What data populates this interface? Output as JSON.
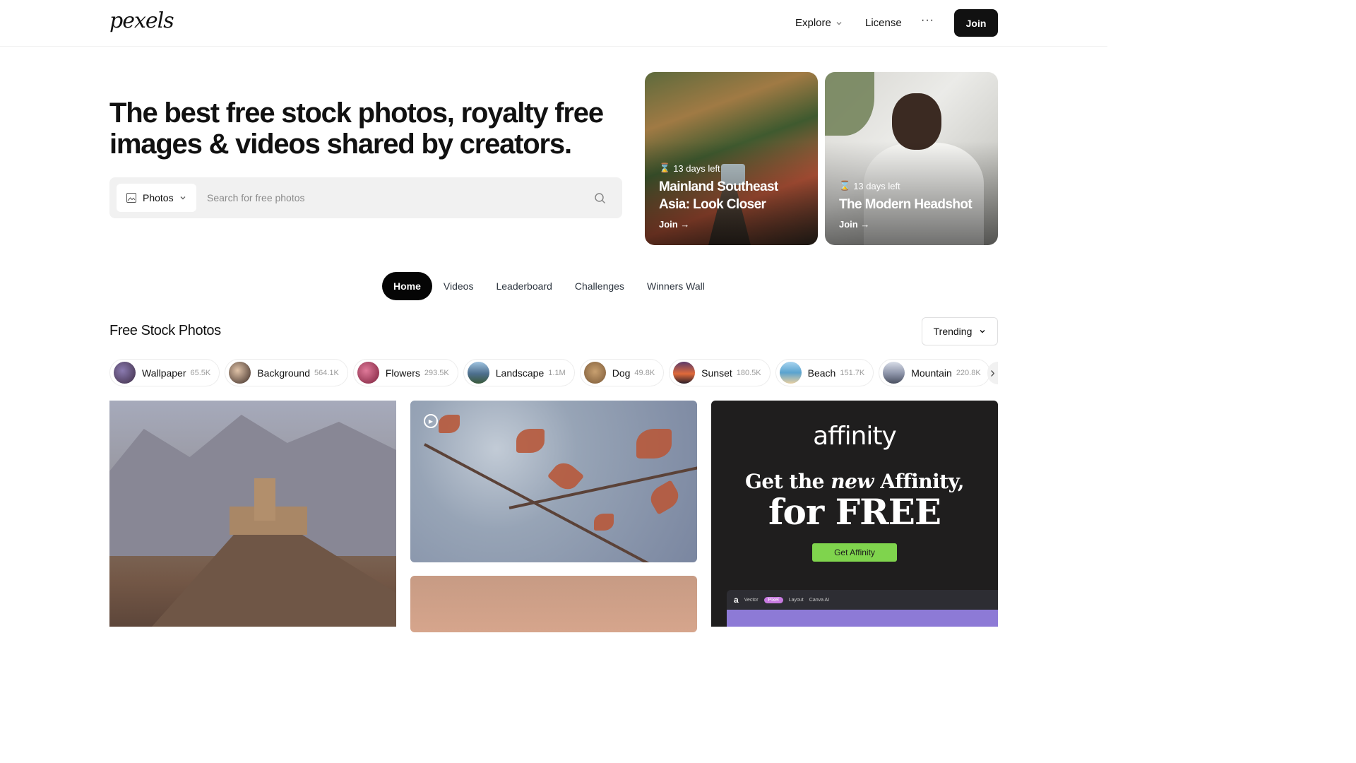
{
  "header": {
    "logo": "pexels",
    "nav": {
      "explore": "Explore",
      "license": "License",
      "more": "···",
      "join": "Join"
    }
  },
  "hero": {
    "title": "The best free stock photos, royalty free images & videos shared by creators.",
    "search": {
      "type_label": "Photos",
      "placeholder": "Search for free photos"
    }
  },
  "challenges": [
    {
      "days_left": "13 days left",
      "title": "Mainland Southeast Asia: Look Closer",
      "cta": "Join →"
    },
    {
      "days_left": "13 days left",
      "title": "The Modern Headshot",
      "cta": "Join →"
    }
  ],
  "tabs": [
    {
      "label": "Home",
      "active": true
    },
    {
      "label": "Videos"
    },
    {
      "label": "Leaderboard"
    },
    {
      "label": "Challenges"
    },
    {
      "label": "Winners Wall"
    }
  ],
  "section": {
    "title": "Free Stock Photos",
    "sort": "Trending"
  },
  "categories": [
    {
      "name": "Wallpaper",
      "count": "65.5K",
      "color": "#5b4a63"
    },
    {
      "name": "Background",
      "count": "564.1K",
      "color": "#6b4a3a"
    },
    {
      "name": "Flowers",
      "count": "293.5K",
      "color": "#b0405e"
    },
    {
      "name": "Landscape",
      "count": "1.1M",
      "color": "#5d7ea0"
    },
    {
      "name": "Dog",
      "count": "49.8K",
      "color": "#b08a5a"
    },
    {
      "name": "Sunset",
      "count": "180.5K",
      "color": "#d0693a"
    },
    {
      "name": "Beach",
      "count": "151.7K",
      "color": "#6ea7c8"
    },
    {
      "name": "Mountain",
      "count": "220.8K",
      "color": "#8c93a8"
    }
  ],
  "ad": {
    "logo": "affinity",
    "headline_pre": "Get the ",
    "headline_new": "new",
    "headline_post": " Affinity,",
    "headline_2": "for FREE",
    "cta": "Get Affinity",
    "toolbar": [
      "a",
      "Vector",
      "Pixel",
      "Layout",
      "Canva AI"
    ]
  }
}
